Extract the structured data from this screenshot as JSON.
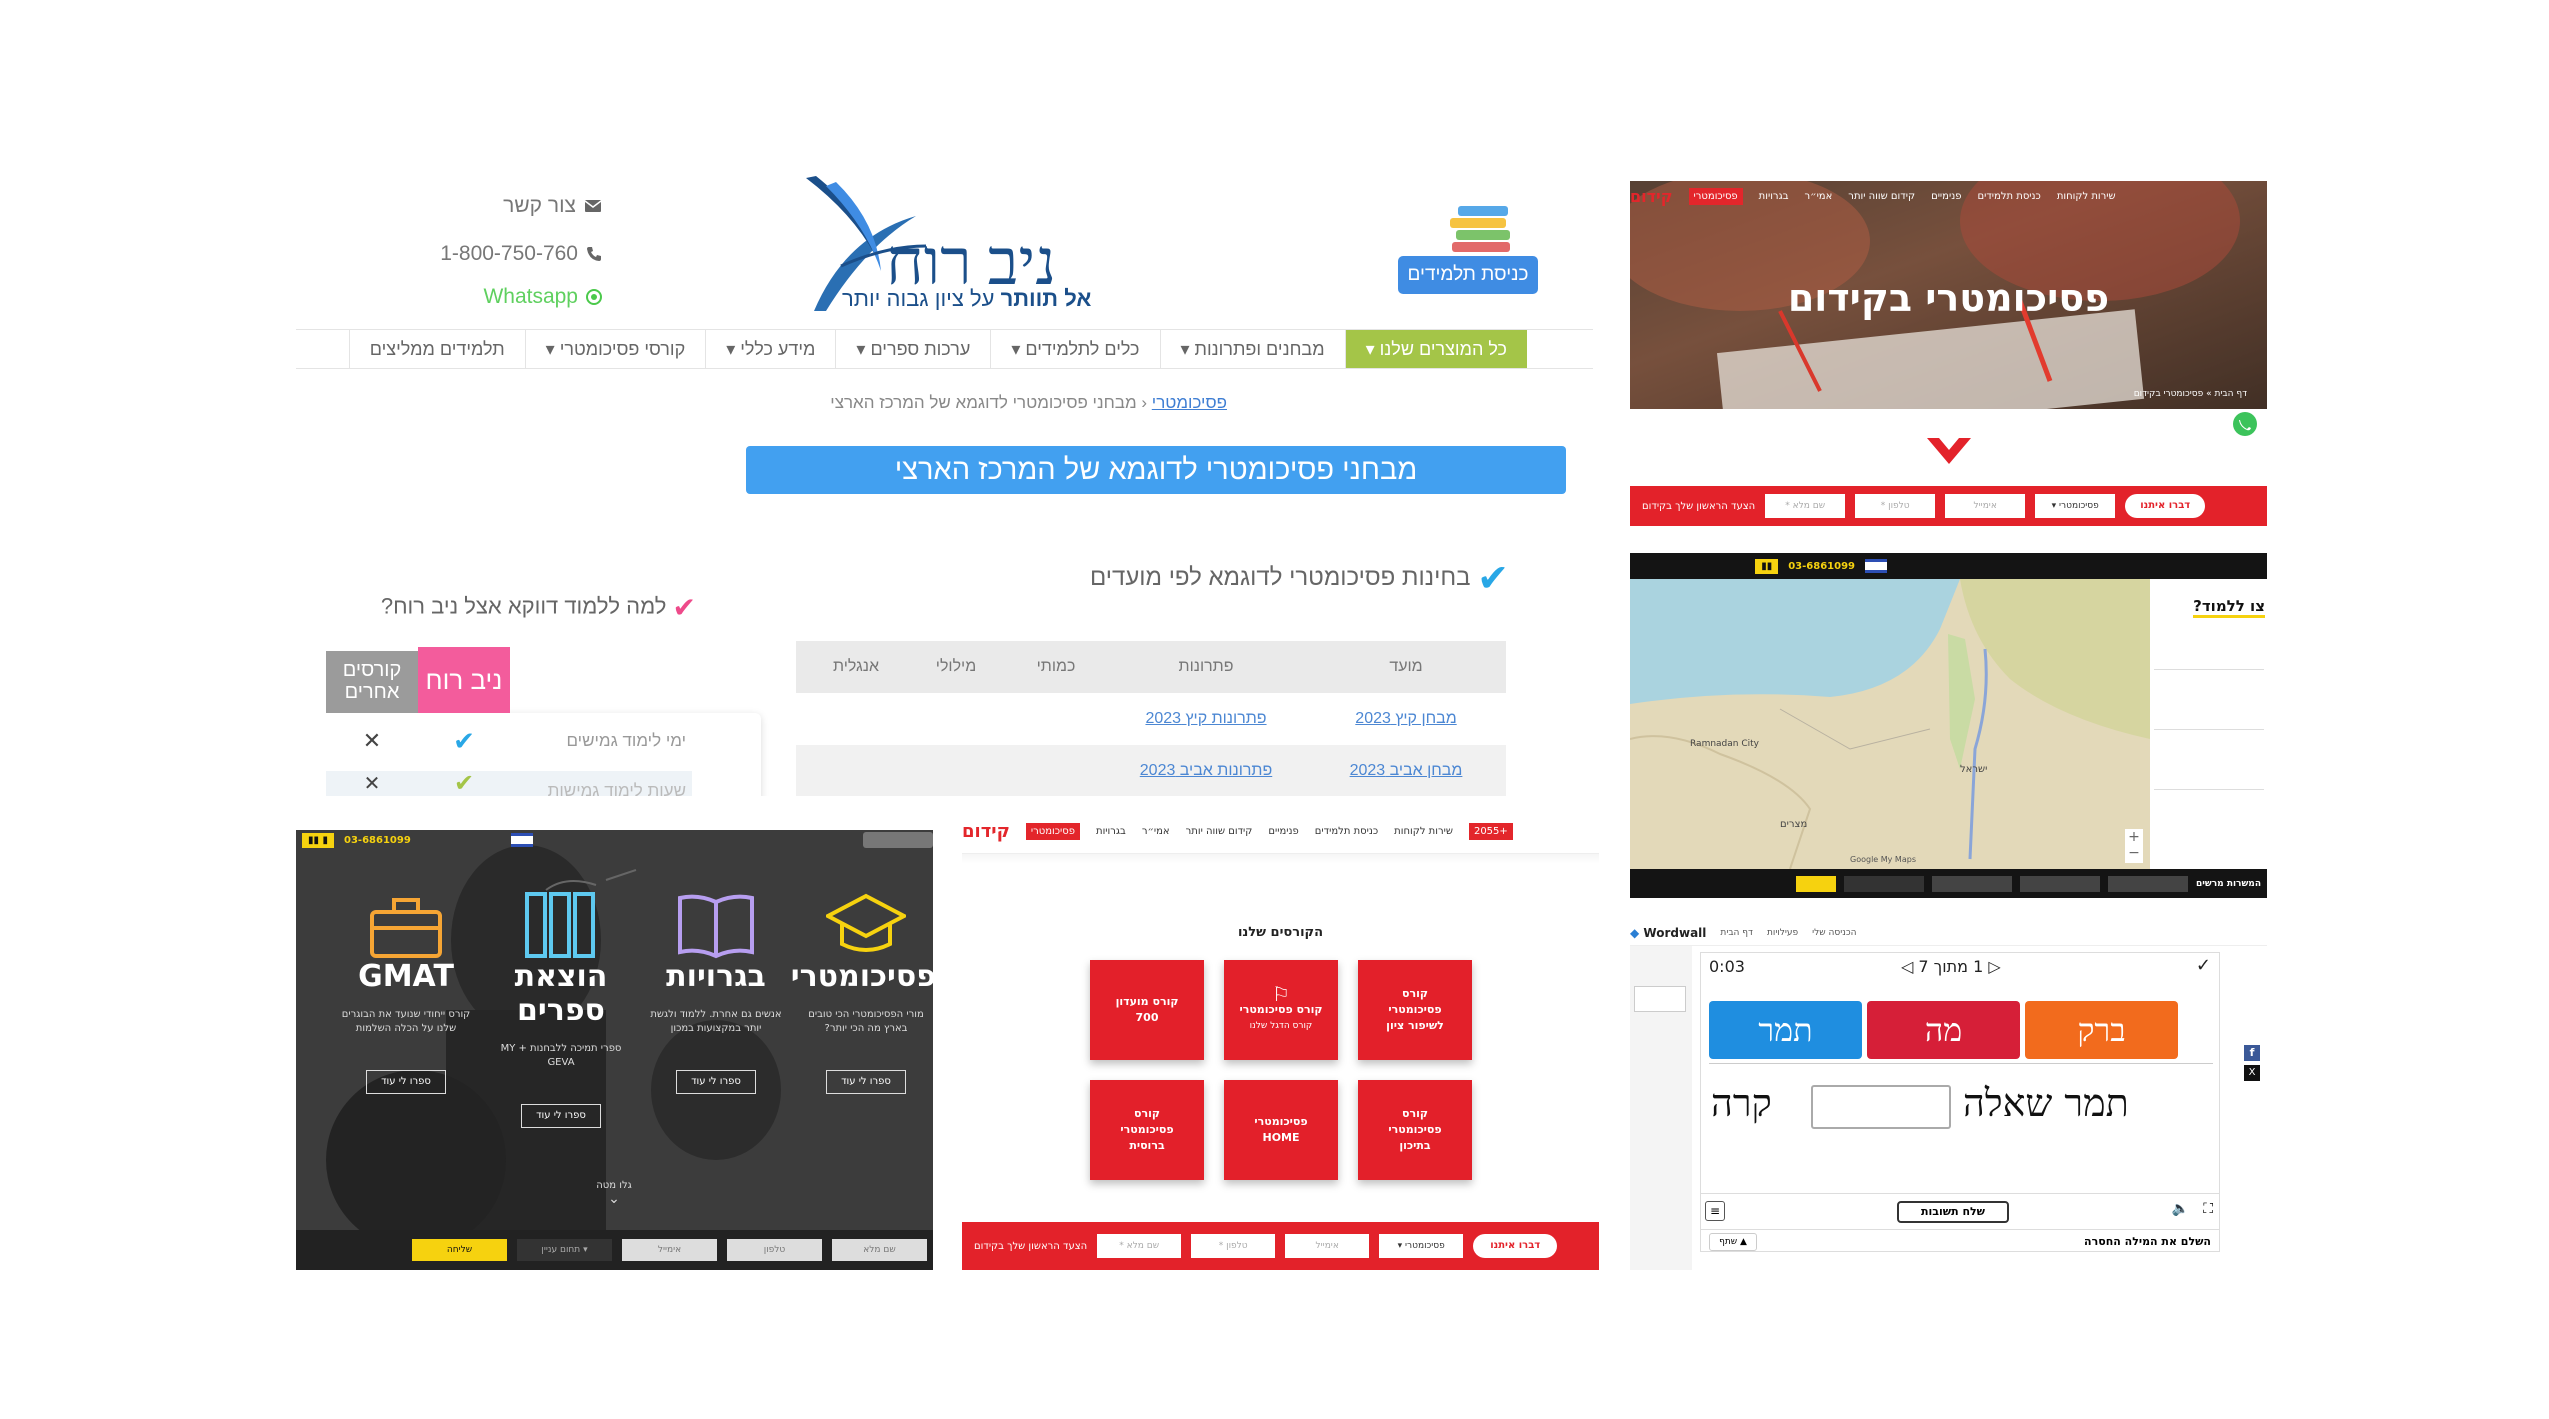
{
  "p1": {
    "contact": {
      "label": "צור קשר",
      "phone": "1-800-750-760",
      "whatsapp": "Whatsapp"
    },
    "logo": {
      "name": "ניב רוח",
      "tagline_a": "אל תוותר",
      "tagline_b": "על ציון גבוה יותר"
    },
    "login": "כניסת תלמידים",
    "menu": [
      "כל המוצרים שלנו",
      "מבחנים ופתרונות",
      "כלים לתלמידים",
      "ערכות ספרים",
      "מידע כללי",
      "קורסי פסיכומטרי",
      "תלמידים ממליצים"
    ],
    "crumb": {
      "link": "פסיכומטרי",
      "current": "מבחני פסיכומטרי לדוגמא של המרכז הארצי"
    },
    "banner": "מבחני פסיכומטרי לדוגמא של המרכז הארצי",
    "section1": "בחינות פסיכומטרי לדוגמא לפי מועדים",
    "section2": "למה ללמוד דווקא אצל ניב רוח?",
    "table": {
      "headers": [
        "מועד",
        "פתרונות",
        "כמותי",
        "מילולי",
        "אנגלית"
      ],
      "rows": [
        [
          "מבחן קיץ 2023",
          "פתרונות קיץ 2023"
        ],
        [
          "מבחן אביב 2023",
          "פתרונות אביב 2023"
        ]
      ]
    },
    "compare": {
      "ours": "ניב רוח",
      "others": "קורסים אחרים",
      "row1": "ימי לימוד גמישים",
      "row2": "שעות לימוד גמישות"
    }
  },
  "p2": {
    "brand": "קידום",
    "nav": [
      "פסיכומטרי",
      "בגרויות",
      "אמי״ר",
      "קידום שווה יותר",
      "פנימיים",
      "כניסת תלמידים",
      "שירות לקוחות"
    ],
    "title": "פסיכומטרי בקידום",
    "crumb": "דף הבית » פסיכומטרי בקידום",
    "form": {
      "lead": "הצעד הראשון שלך בקידום",
      "name": "שם מלא *",
      "phone": "טלפון *",
      "email": "אימייל",
      "select": "פסיכומטרי",
      "submit": "דברו איתנו"
    }
  },
  "p3": {
    "phone": "03-6861099",
    "side": "צו ללמוד?",
    "map_labels": [
      "ישראל",
      "Ramnadan City",
      "מצרים"
    ],
    "bottom": "המשרות מרשים",
    "attrib": "Google My Maps"
  },
  "p4": {
    "phone": "03-6861099",
    "courses": [
      {
        "title": "GMAT",
        "desc": "קורס ייחודי שנועד את הבוגרים שלנו על הכלה השלמות",
        "btn": "ספרו לי עוד"
      },
      {
        "title": "הוצאת ספרים",
        "desc": "ספרי תמיכה ללבחנות + MY GEVA",
        "btn": "ספרו לי עוד"
      },
      {
        "title": "בגרויות",
        "desc": "אנשים גם אחרת. ללמוד ולגשת יותר במקצועות במכון",
        "btn": "ספרו לי עוד"
      },
      {
        "title": "פסיכומטרי",
        "desc": "מורי הפסיכומטרי הכי טובים בארץ מה הכי יותר?",
        "btn": "ספרו לי עוד"
      }
    ],
    "more": "גלו מטה",
    "form": {
      "name": "שם מלא",
      "phone": "טלפון",
      "email": "אימייל",
      "select": "תחום עניין",
      "submit": "שליחה"
    }
  },
  "p5": {
    "brand": "קידום",
    "nav": [
      "פסיכומטרי",
      "בגרויות",
      "אמי״ר",
      "קידום שווה יותר",
      "פנימיים",
      "כניסת תלמידים",
      "שירות לקוחות"
    ],
    "badge": "+2055",
    "heading": "הקורסים שלנו",
    "tiles": [
      [
        "קורס",
        "פסיכומטרי",
        "לשיפור ציון"
      ],
      [
        "קורס פסיכומטרי",
        "",
        "קורס הדגל שלנו"
      ],
      [
        "קורס מועדון",
        "700"
      ],
      [
        "קורס",
        "פסיכומטרי",
        "בתיכון"
      ],
      [
        "פסיכומטרי",
        "HOME"
      ],
      [
        "קורס",
        "פסיכומטרי",
        "ברוסית"
      ]
    ],
    "form": {
      "lead": "הצעד הראשון שלך בקידום",
      "name": "שם מלא *",
      "phone": "טלפון *",
      "email": "אימייל",
      "select": "פסיכומטרי",
      "submit": "דברו איתנו"
    }
  },
  "p6": {
    "brand": "Wordwall",
    "nav": [
      "דף הבית",
      "פעילויות",
      "הכניסה שלי"
    ],
    "time": "0:03",
    "counter": "1 מתוך 7",
    "answers": [
      "ברק",
      "מה",
      "תמר"
    ],
    "sentence_a": "תמר שאלה",
    "sentence_b": "קרה",
    "submit": "שלח תשובות",
    "footer": "השלם את המילה החסרה",
    "share": "שתף",
    "colors": {
      "orange": "#f26b1d",
      "red": "#d61f38",
      "blue": "#1f8ee0"
    }
  }
}
